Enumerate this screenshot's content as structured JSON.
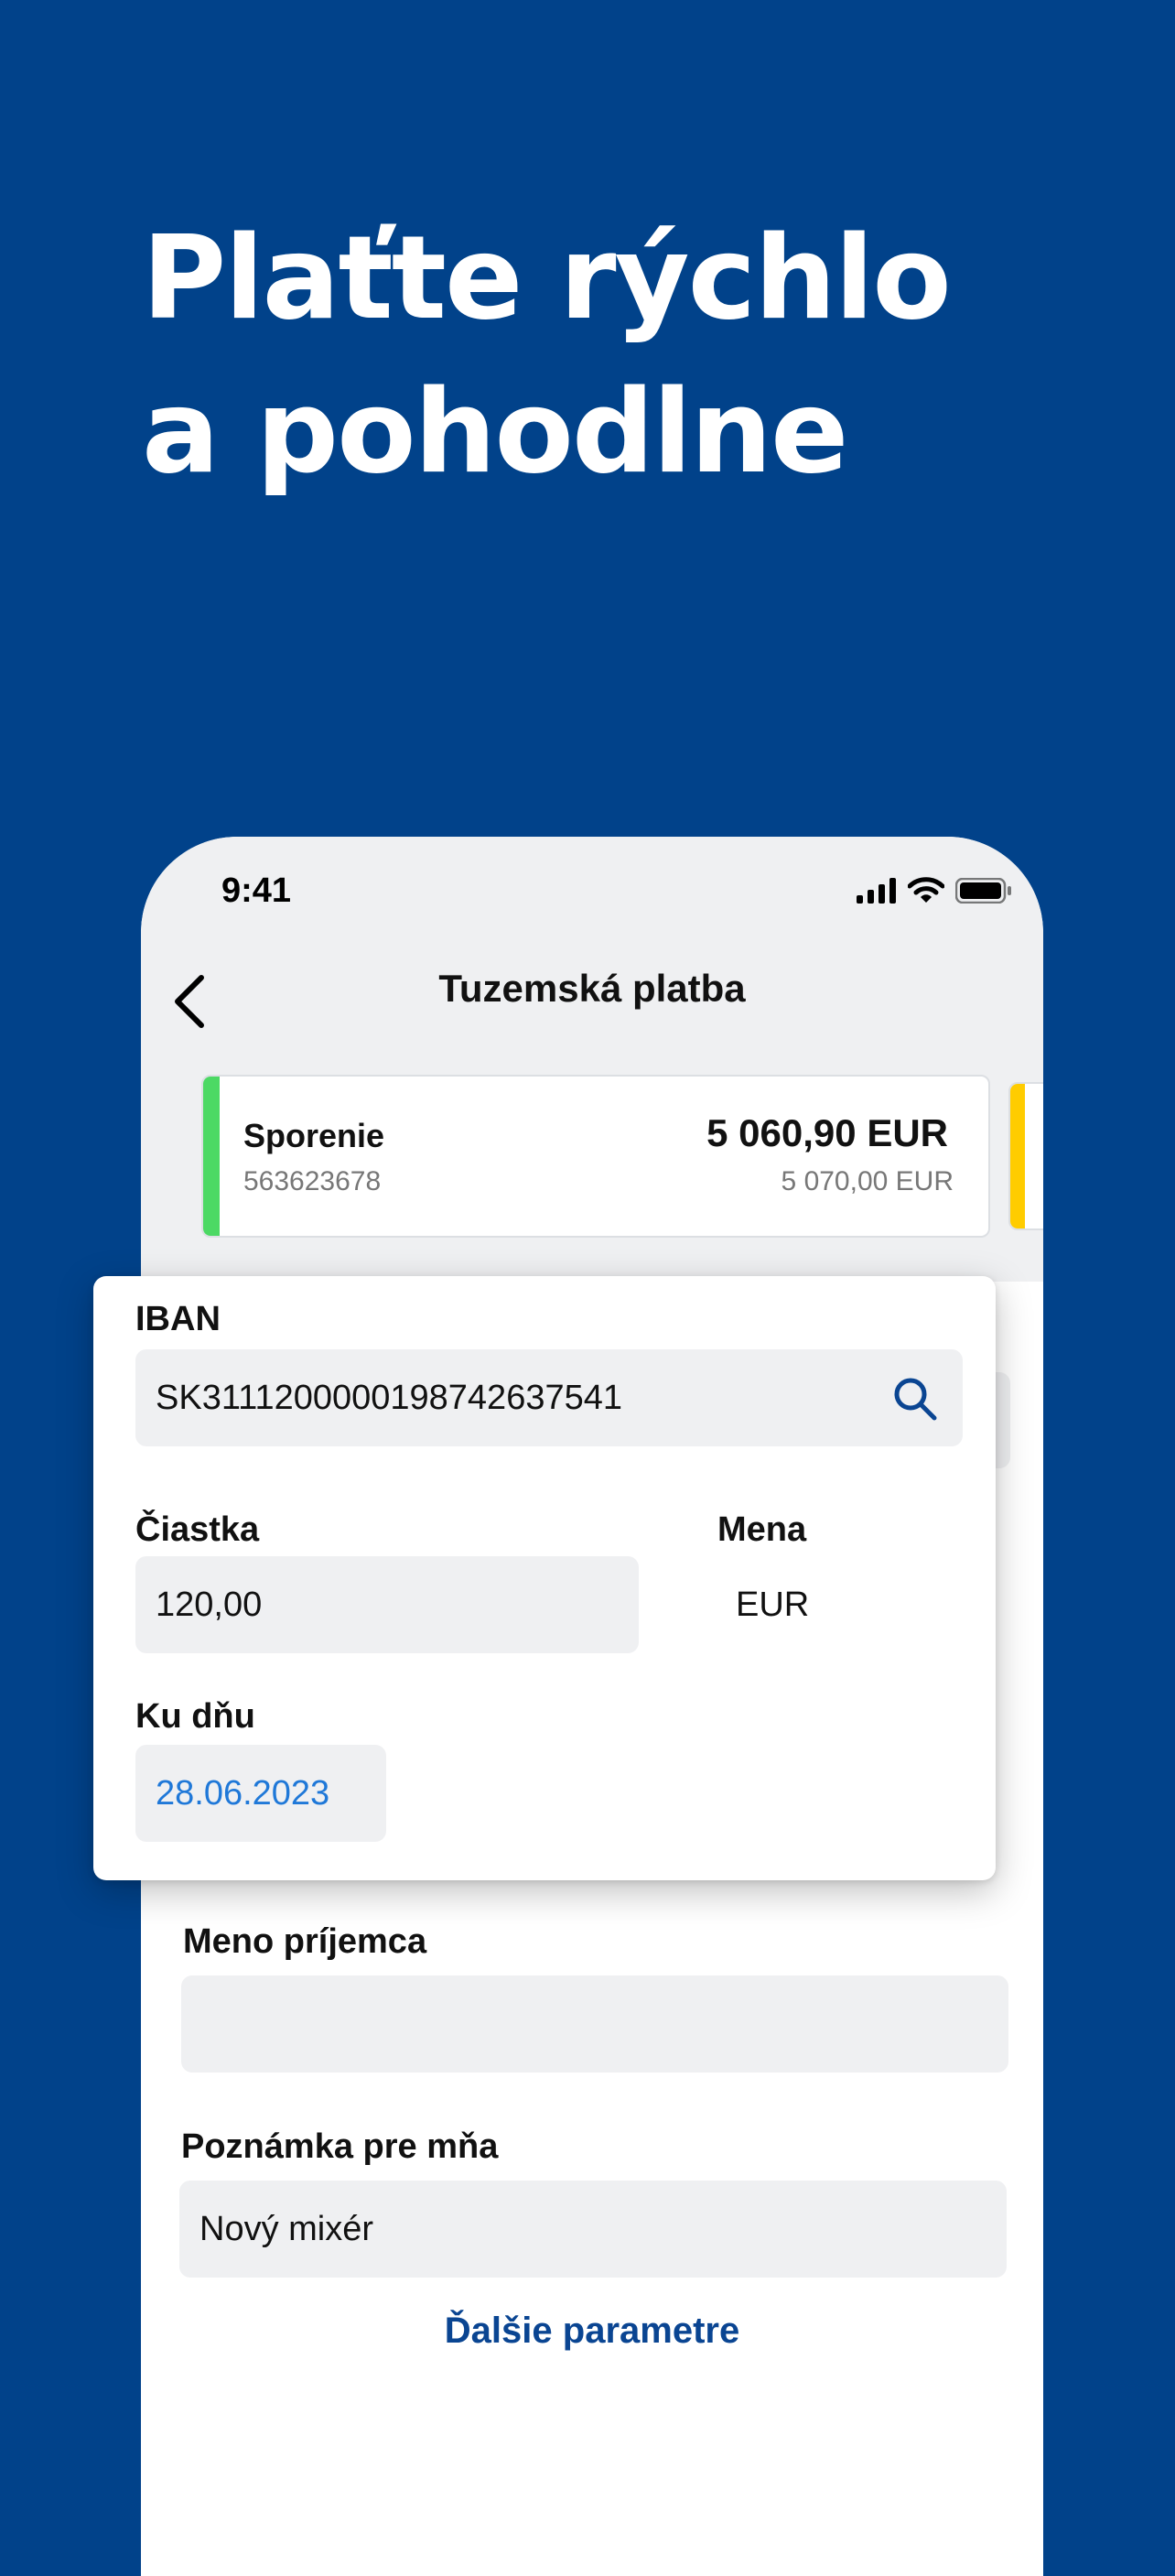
{
  "headline": {
    "line1": "Plaťte rýchlo",
    "line2": "a pohodlne"
  },
  "status_bar": {
    "time": "9:41"
  },
  "nav": {
    "title": "Tuzemská platba"
  },
  "account": {
    "name": "Sporenie",
    "number": "563623678",
    "balance": "5 060,90 EUR",
    "available": "5 070,00 EUR",
    "accent_color": "#4cd964"
  },
  "next_account": {
    "accent_color": "#ffcc00"
  },
  "form": {
    "iban": {
      "label": "IBAN",
      "value": "SK3111200000198742637541"
    },
    "amount": {
      "label": "Čiastka",
      "value": "120,00"
    },
    "currency": {
      "label": "Mena",
      "value": "EUR"
    },
    "date": {
      "label": "Ku dňu",
      "value": "28.06.2023"
    },
    "recipient": {
      "label": "Meno príjemca",
      "value": ""
    },
    "note": {
      "label": "Poznámka pre mňa",
      "value": "Nový mixér"
    },
    "more_parameters": "Ďalšie parametre"
  },
  "colors": {
    "background": "#01428a",
    "link": "#0a4592",
    "date_value": "#1f78d8"
  }
}
